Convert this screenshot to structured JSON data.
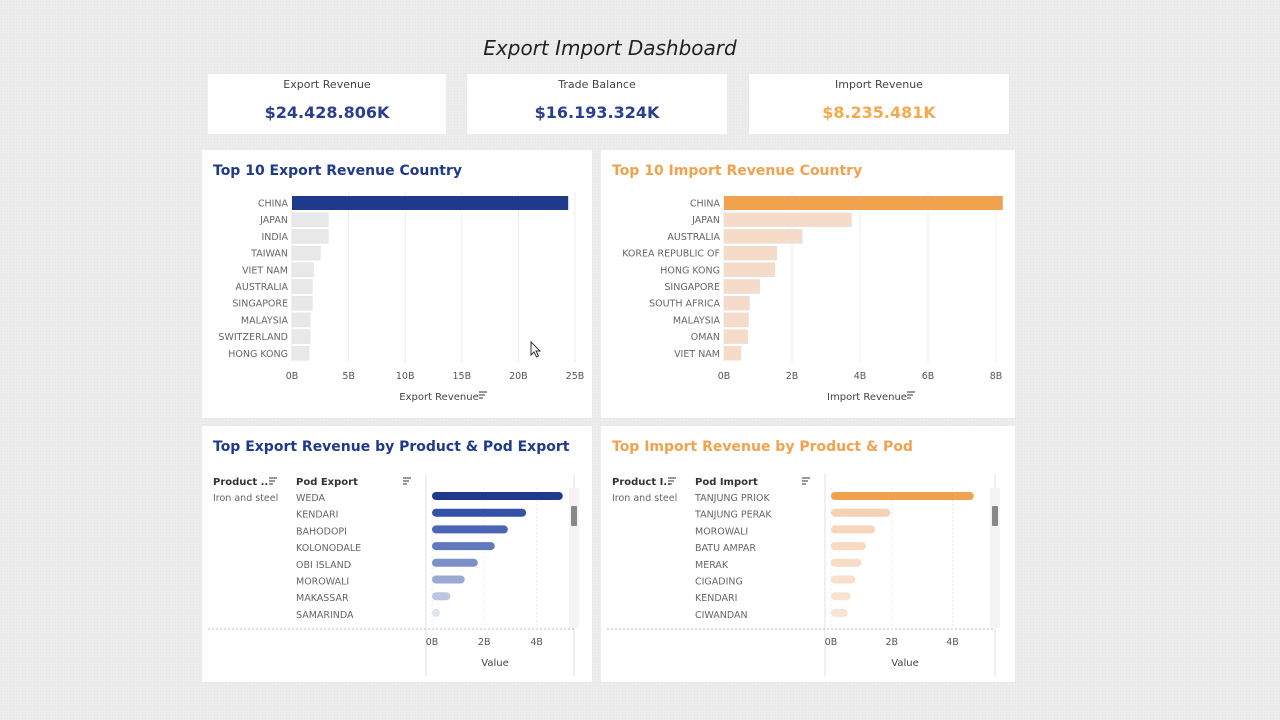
{
  "dashboard": {
    "title": "Export Import Dashboard"
  },
  "kpis": [
    {
      "label": "Export Revenue",
      "value": "$24.428.806K",
      "color": "#2a3f8f"
    },
    {
      "label": "Trade Balance",
      "value": "$16.193.324K",
      "color": "#2a3f8f"
    },
    {
      "label": "Import Revenue",
      "value": "$8.235.481K",
      "color": "#f5a94f"
    }
  ],
  "colors": {
    "blue": "#1f3a8a",
    "orange": "#f2a24e",
    "faded_blue": "#e8e8e8",
    "faded_orange": "#f6dcc8"
  },
  "chart_data": [
    {
      "type": "bar",
      "title": "Top 10 Export Revenue Country",
      "categories": [
        "CHINA",
        "JAPAN",
        "INDIA",
        "TAIWAN",
        "VIET NAM",
        "AUSTRALIA",
        "SINGAPORE",
        "MALAYSIA",
        "SWITZERLAND",
        "HONG KONG"
      ],
      "values": [
        24.4,
        3.2,
        3.2,
        2.5,
        1.9,
        1.8,
        1.8,
        1.6,
        1.6,
        1.5
      ],
      "xlabel": "Export Revenue",
      "ticks": [
        "0B",
        "5B",
        "10B",
        "15B",
        "20B",
        "25B"
      ],
      "xlim": [
        0,
        25
      ],
      "grid": true,
      "highlight_color": "#1f3a8a",
      "faded_color": "#e8e8e8"
    },
    {
      "type": "bar",
      "title": "Top 10 Import Revenue Country",
      "categories": [
        "CHINA",
        "JAPAN",
        "AUSTRALIA",
        "KOREA REPUBLIC OF",
        "HONG KONG",
        "SINGAPORE",
        "SOUTH AFRICA",
        "MALAYSIA",
        "OMAN",
        "VIET NAM"
      ],
      "values": [
        8.2,
        3.75,
        2.3,
        1.55,
        1.5,
        1.05,
        0.75,
        0.72,
        0.7,
        0.5
      ],
      "xlabel": "Import Revenue",
      "ticks": [
        "0B",
        "2B",
        "4B",
        "6B",
        "8B"
      ],
      "xlim": [
        0,
        8
      ],
      "grid": true,
      "highlight_color": "#f2a24e",
      "faded_color": "#f6dcc8"
    },
    {
      "type": "bar",
      "title": "Top Export Revenue by Product & Pod Export",
      "col1_header": "Product ..",
      "col2_header": "Pod Export",
      "product": "Iron and steel",
      "categories": [
        "WEDA",
        "KENDARI",
        "BAHODOPI",
        "KOLONODALE",
        "OBI ISLAND",
        "MOROWALI",
        "MAKASSAR",
        "SAMARINDA"
      ],
      "values": [
        5.0,
        3.6,
        2.9,
        2.4,
        1.75,
        1.25,
        0.7,
        0.3
      ],
      "xlabel": "Value",
      "ticks": [
        "0B",
        "2B",
        "4B"
      ],
      "xlim": [
        0,
        5.2
      ],
      "grid": true,
      "colors": [
        "#1f3a8a",
        "#3452a8",
        "#4a66b4",
        "#6278bd",
        "#7d8fc8",
        "#9aa8d4",
        "#bcc6e2",
        "#dde2ef"
      ]
    },
    {
      "type": "bar",
      "title": "Top Import Revenue by Product & Pod",
      "col1_header": "Product I..",
      "col2_header": "Pod Import",
      "product": "Iron and steel",
      "categories": [
        "TANJUNG PRIOK",
        "TANJUNG PERAK",
        "MOROWALI",
        "BATU AMPAR",
        "MERAK",
        "CIGADING",
        "KENDARI",
        "CIWANDAN"
      ],
      "values": [
        4.7,
        1.95,
        1.45,
        1.15,
        1.0,
        0.8,
        0.65,
        0.55
      ],
      "xlabel": "Value",
      "ticks": [
        "0B",
        "2B",
        "4B"
      ],
      "xlim": [
        0,
        5.2
      ],
      "grid": true,
      "colors": [
        "#f2a24e",
        "#f6d2b4",
        "#f6d6bc",
        "#f7dac2",
        "#f7dcc6",
        "#f8e0cc",
        "#f8e2d0",
        "#f9e4d3"
      ]
    }
  ]
}
